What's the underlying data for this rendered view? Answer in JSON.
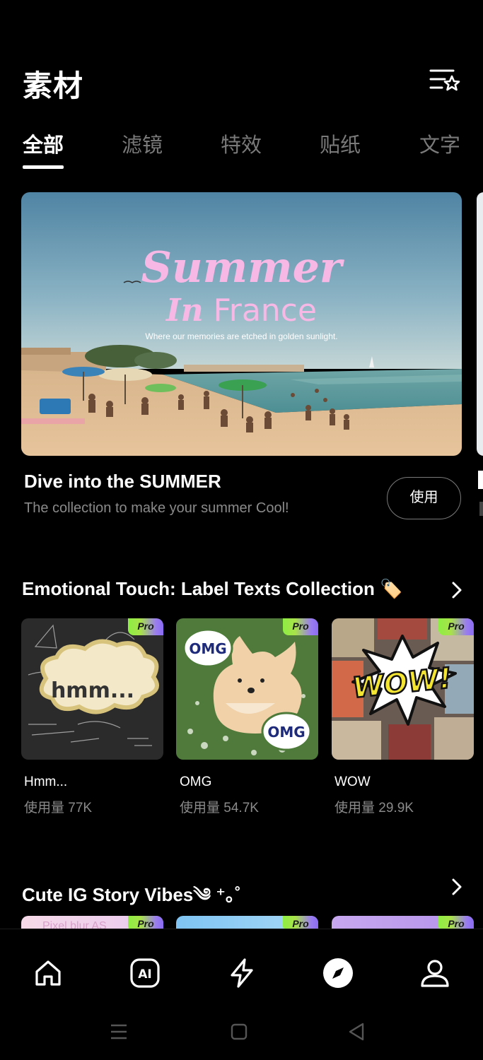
{
  "header": {
    "title": "素材",
    "favorites_icon": "list-star-icon"
  },
  "tabs": [
    {
      "label": "全部",
      "active": true
    },
    {
      "label": "滤镜",
      "active": false
    },
    {
      "label": "特效",
      "active": false
    },
    {
      "label": "贴纸",
      "active": false
    },
    {
      "label": "文字",
      "active": false
    }
  ],
  "featured": {
    "banner_line1": "Summer",
    "banner_line2_a": "In",
    "banner_line2_b": "France",
    "banner_caption": "Where our memories are etched in golden sunlight.",
    "title": "Dive into the SUMMER",
    "description": "The collection to make your summer Cool!",
    "use_label": "使用"
  },
  "section1": {
    "title": "Emotional Touch: Label Texts Collection 🏷️",
    "cards": [
      {
        "name": "Hmm...",
        "usage": "使用量 77K",
        "badge": "Pro",
        "art_text": "hmm..."
      },
      {
        "name": "OMG",
        "usage": "使用量 54.7K",
        "badge": "Pro",
        "art_text": "OMG"
      },
      {
        "name": "WOW",
        "usage": "使用量 29.9K",
        "badge": "Pro",
        "art_text": "WOW!"
      }
    ]
  },
  "section2": {
    "title": "Cute IG Story Vibes༄ ⁺｡˚",
    "cards": [
      {
        "badge": "Pro",
        "art_text": "Pixel blur AS"
      },
      {
        "badge": "Pro"
      },
      {
        "badge": "Pro"
      }
    ]
  },
  "bottom_nav": [
    {
      "icon": "home-icon"
    },
    {
      "icon": "ai-icon",
      "text": "AI"
    },
    {
      "icon": "lightning-icon"
    },
    {
      "icon": "compass-icon",
      "active": true
    },
    {
      "icon": "profile-icon"
    }
  ],
  "system_nav": [
    "menu-icon",
    "home-square-icon",
    "back-triangle-icon"
  ]
}
